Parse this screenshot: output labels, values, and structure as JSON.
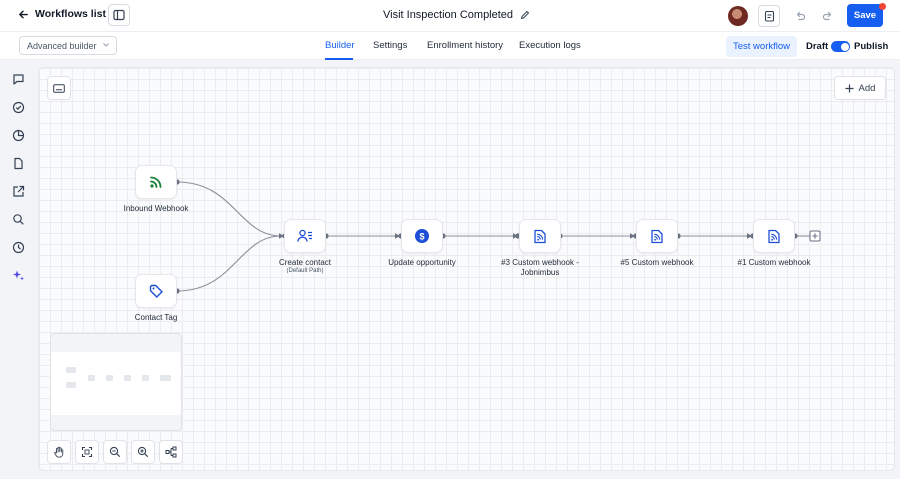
{
  "header": {
    "back_label": "Workflows list",
    "workflow_title": "Visit Inspection Completed",
    "save_label": "Save"
  },
  "tabs_bar": {
    "builder_mode": "Advanced builder",
    "tabs": [
      {
        "label": "Builder",
        "active": true
      },
      {
        "label": "Settings",
        "active": false
      },
      {
        "label": "Enrollment history",
        "active": false
      },
      {
        "label": "Execution logs",
        "active": false
      }
    ],
    "test_label": "Test workflow",
    "draft_label": "Draft",
    "publish_label": "Publish",
    "publish_toggle_on": true
  },
  "sidebar": {
    "icons": [
      "chat-icon",
      "check-circle-icon",
      "pie-chart-icon",
      "file-icon",
      "share-icon",
      "search-icon",
      "history-icon",
      "sparkle-icon"
    ]
  },
  "canvas": {
    "add_label": "Add",
    "nodes": {
      "trigger_webhook": {
        "label": "Inbound Webhook",
        "icon": "rss-icon"
      },
      "trigger_tag": {
        "label": "Contact Tag",
        "icon": "tag-icon"
      },
      "create_contact": {
        "label": "Create contact",
        "sublabel": "(Default Path)",
        "icon": "contact-icon"
      },
      "update_opportunity": {
        "label": "Update opportunity",
        "icon": "dollar-icon"
      },
      "webhook_3": {
        "label": "#3 Custom webhook -",
        "label_line2": "Jobnimbus",
        "icon": "webhook-file-icon"
      },
      "webhook_5": {
        "label": "#5 Custom webhook",
        "icon": "webhook-file-icon"
      },
      "webhook_1": {
        "label": "#1 Custom webhook",
        "icon": "webhook-file-icon"
      }
    }
  },
  "colors": {
    "accent": "#155eef",
    "webhook_green": "#1a7f37",
    "edge": "#8a8f98",
    "node_icon": "#1d4ed8"
  }
}
